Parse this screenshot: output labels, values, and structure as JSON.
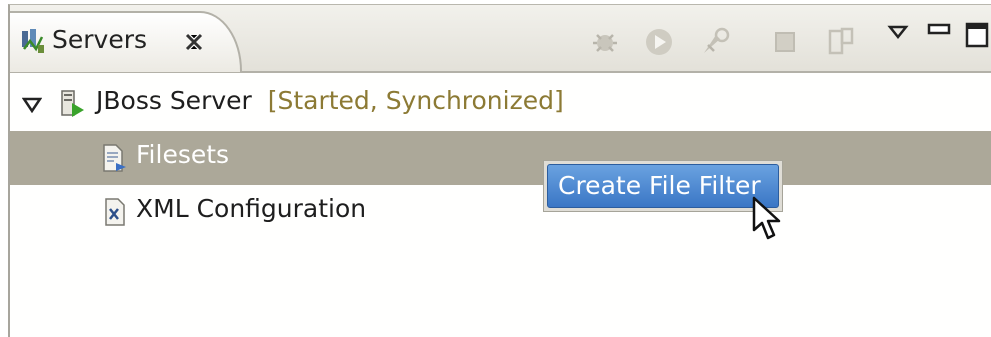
{
  "view": {
    "tab_title": "Servers",
    "icons": {
      "tab": "servers-view-icon",
      "close": "close-icon",
      "toolbar": [
        "debug-icon",
        "start-icon",
        "profile-icon",
        "stop-icon",
        "publish-icon",
        "view-menu-icon",
        "minimize-icon",
        "maximize-icon"
      ]
    }
  },
  "tree": {
    "server": {
      "name": "JBoss Server",
      "status": "[Started, Synchronized]",
      "expanded": true,
      "children": [
        {
          "label": "Filesets",
          "icon": "fileset-icon",
          "selected": true
        },
        {
          "label": "XML Configuration",
          "icon": "xml-file-icon",
          "selected": false
        }
      ]
    }
  },
  "context_menu": {
    "items": [
      {
        "label": "Create File Filter",
        "highlighted": true
      }
    ]
  },
  "colors": {
    "selection": "#aca899",
    "status_text": "#8c7a34",
    "menu_highlight": "#3a76c5"
  }
}
